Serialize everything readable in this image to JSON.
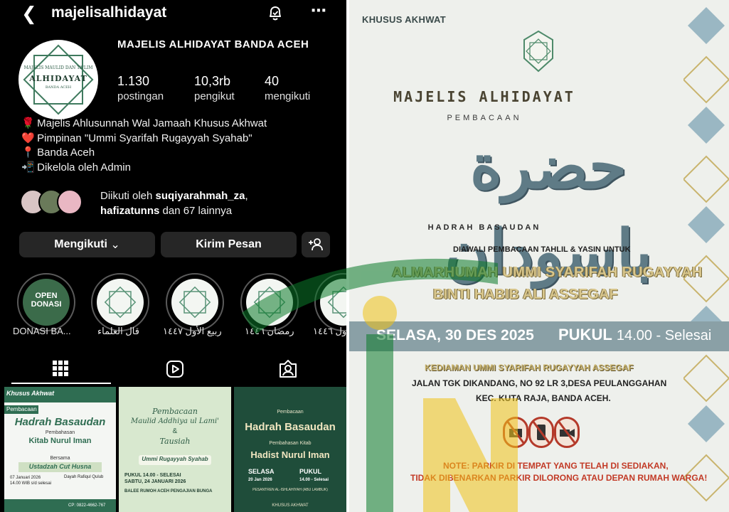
{
  "instagram": {
    "username": "majelisalhidayat",
    "avatar_text": {
      "line1": "MAJELIS MAULID DAN TA'LIM",
      "line2": "ALHIDAYAT",
      "line3": "BANDA ACEH"
    },
    "full_name": "MAJELIS ALHIDAYAT BANDA ACEH",
    "stats": [
      {
        "value": "1.130",
        "label": "postingan"
      },
      {
        "value": "10,3rb",
        "label": "pengikut"
      },
      {
        "value": "40",
        "label": "mengikuti"
      }
    ],
    "bio": [
      {
        "emoji": "🌹",
        "text": "Majelis Ahlusunnah Wal Jamaah Khusus Akhwat"
      },
      {
        "emoji": "❤️",
        "text": "Pimpinan \"Ummi Syarifah Rugayyah Syahab\""
      },
      {
        "emoji": "📍",
        "text": "Banda Aceh"
      },
      {
        "emoji": "📲",
        "text": "Dikelola oleh Admin"
      }
    ],
    "followed_by": {
      "prefix": "Diikuti oleh ",
      "user1": "suqiyarahmah_za",
      "comma": ",",
      "user2": "hafizatunns",
      "suffix": " dan 67 lainnya"
    },
    "buttons": {
      "following": "Mengikuti",
      "following_chevron": "⌄",
      "message": "Kirim Pesan"
    },
    "highlights": [
      {
        "label": "DONASI BA...",
        "cover_text": "OPEN DONASI"
      },
      {
        "label": "قال العلماء"
      },
      {
        "label": "ربيع الأول ١٤٤٧"
      },
      {
        "label": "رمضان ١٤٤٦"
      },
      {
        "label": "ول ١٤٤٦"
      }
    ],
    "posts": [
      {
        "header": "Khusus Akhwat",
        "tag": "Pembacaan",
        "title": "Hadrah Basaudan",
        "subtitle": "Pembahasan",
        "book": "Kitab Nurul Iman",
        "bersama": "Bersama",
        "speaker": "Ustadzah Cut Husna",
        "date": "07 Januari 2026",
        "time": "14.00 WIB s/d selesai",
        "place": "Dayah Rafiqul Qulub",
        "phone": "CP: 0822-4662-767"
      },
      {
        "line1": "Pembacaan",
        "line2": "Maulid Addhiya ul Lami'",
        "amp": "&",
        "line3": "Tausiah",
        "by": "Ummi Rugayyah Syahab",
        "time": "PUKUL 14.00 - SELESAI",
        "date": "SABTU, 24 JANUARI 2026",
        "place": "BALEE RUMOH ACEH PENGAJIAN BUNGA"
      },
      {
        "line1": "Pembacaan",
        "line2": "Hadrah Basaudan",
        "line3": "Pembahasan Kitab",
        "line4": "Hadist Nurul Iman",
        "day": "SELASA",
        "date": "20 Jan 2026",
        "pukul": "PUKUL",
        "time": "14.00 - Selesai",
        "place": "PESANTREN AL-ISHLAHIYAH (ABU LAMBUK)",
        "footer": "KHUSUS AKHWAT"
      }
    ]
  },
  "poster": {
    "khusus": "KHUSUS AKHWAT",
    "logo_text": "MAJELIS ALHIDAYAT",
    "title": "MAJELIS ALHIDAYAT",
    "pembacaan": "PEMBACAAN",
    "arabic": "حضرة باسودان",
    "subtitle": "HADRAH BASAUDAN",
    "diawali": "DIAWALI PEMBACAAN TAHLIL & YASIN UNTUK",
    "almarhumah_line1": "ALMARHUMAH UMMI SYARIFAH RUGAYYAH",
    "almarhumah_line2": "BINTI HABIB ALI ASSEGAF",
    "date": "SELASA, 30 DES 2025",
    "pukul": "PUKUL",
    "time": "14.00 - Selesai",
    "venue": "KEDIAMAN UMMI SYARIFAH RUGAYYAH ASSEGAF",
    "address1": "JALAN TGK DIKANDANG, NO 92 LR 3,DESA PEULANGGAHAN",
    "address2": "KEC. KUTA RAJA, BANDA ACEH.",
    "note1": "NOTE: PARKIR DI TEMPAT YANG TELAH DI SEDIAKAN,",
    "note2": "TIDAK DIBENARKAN PARKIR DILORONG ATAU DEPAN RUMAH WARGA!",
    "prohibited_icons": [
      "no-camera-icon",
      "no-phone-icon",
      "no-video-icon"
    ]
  },
  "colors": {
    "ig_bg": "#000000",
    "ig_button": "#262626",
    "poster_bg": "#eef0ec",
    "poster_gold": "#d8c68c",
    "poster_teal": "#5f7b86",
    "note_red": "#c23a26",
    "watermark_green": "#0b7a2a",
    "watermark_yellow": "#f0c419"
  }
}
